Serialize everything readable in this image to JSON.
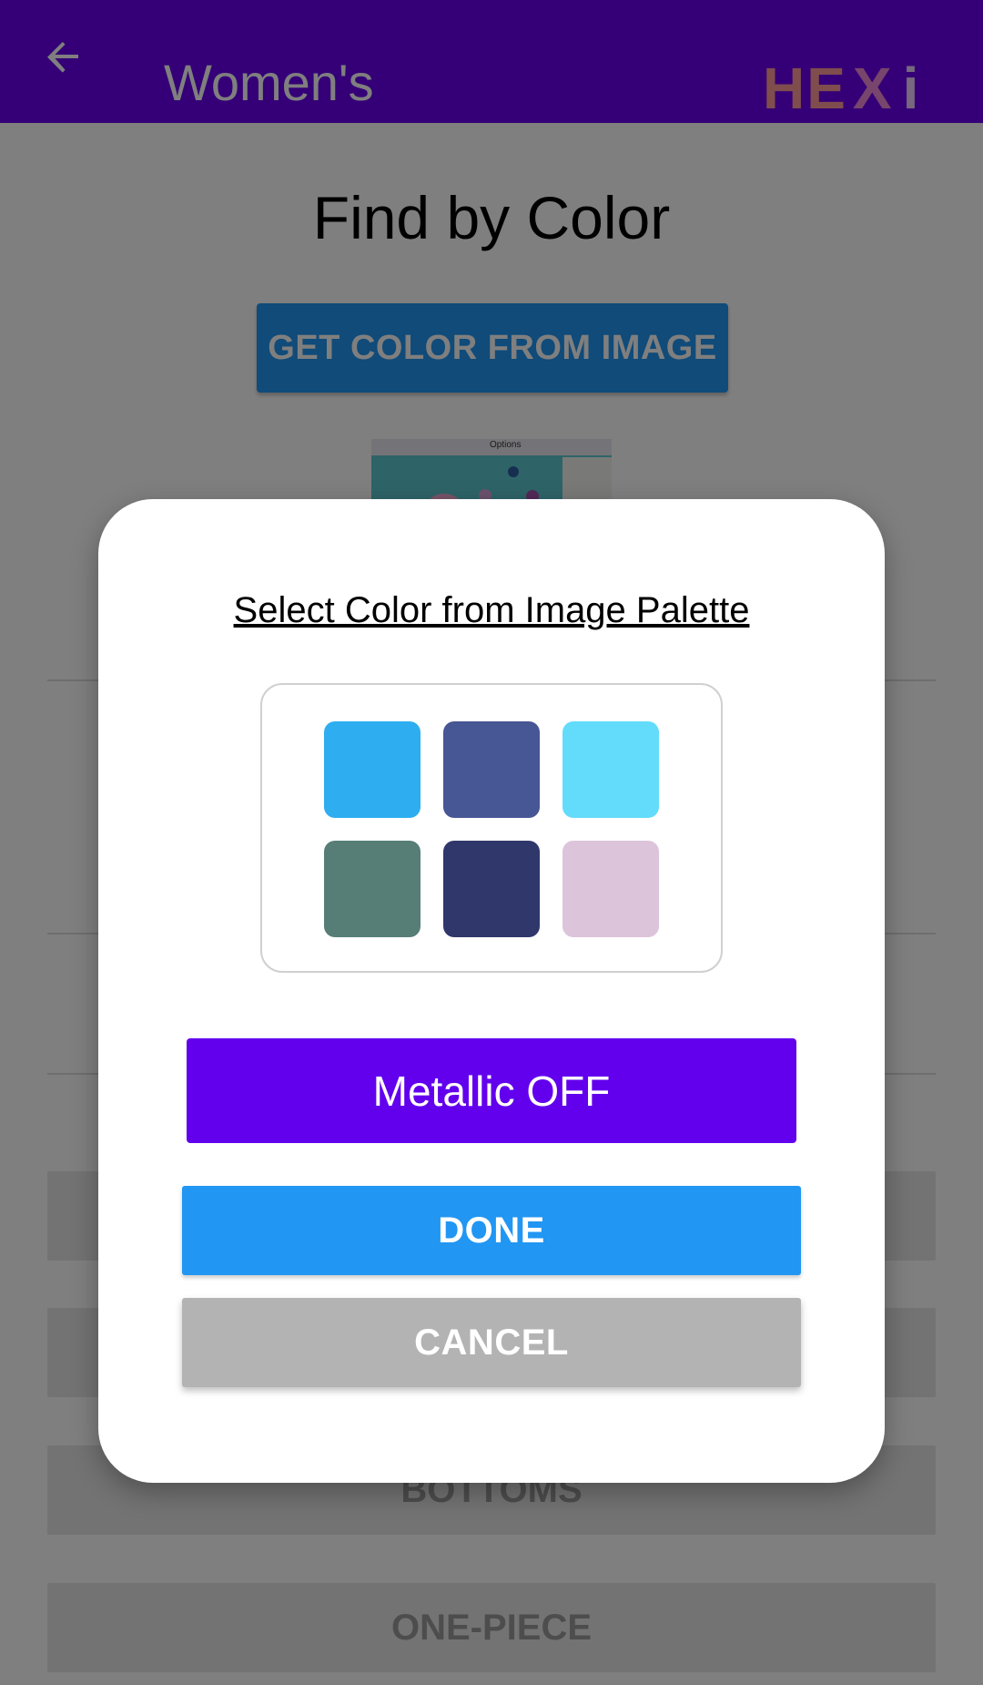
{
  "app_bar": {
    "title": "Women's",
    "back_icon": "arrow-left-icon",
    "logo": {
      "letters": [
        "H",
        "E",
        "X",
        "i"
      ],
      "colors": [
        "#ff9a9a",
        "#ff9a9a",
        "#f08ad8",
        "#f0d0ff"
      ]
    }
  },
  "page": {
    "title": "Find by Color",
    "get_color_button": "GET COLOR FROM IMAGE",
    "thumbnail_label": "Options",
    "categories": [
      "",
      "",
      "BOTTOMS",
      "ONE-PIECE"
    ]
  },
  "dialog": {
    "title": "Select Color from Image Palette",
    "palette": [
      "#2eaef0",
      "#475694",
      "#63dcfc",
      "#567e77",
      "#30376a",
      "#dcc4da"
    ],
    "metallic_button": "Metallic OFF",
    "done_button": "DONE",
    "cancel_button": "CANCEL"
  },
  "colors": {
    "app_bar": "#6a00ee",
    "primary_blue": "#2196f3",
    "metallic": "#6200ee",
    "cancel": "#b3b3b3"
  }
}
